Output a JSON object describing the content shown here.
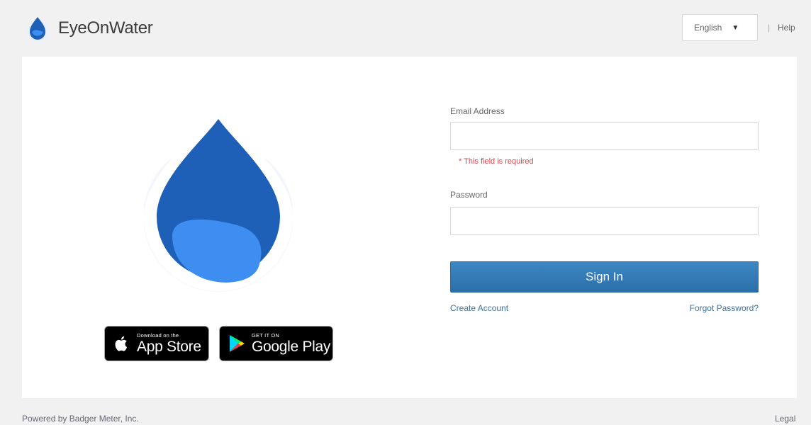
{
  "header": {
    "brand_name": "EyeOnWater",
    "language": {
      "selected": "English"
    },
    "separator": "|",
    "help_label": "Help"
  },
  "login": {
    "email_label": "Email Address",
    "email_value": "",
    "email_error": "* This field is required",
    "password_label": "Password",
    "password_value": "",
    "signin_label": "Sign In",
    "create_account_label": "Create Account",
    "forgot_password_label": "Forgot Password?"
  },
  "badges": {
    "app_store": {
      "small": "Download on the",
      "big": "App Store"
    },
    "google_play": {
      "small": "GET IT ON",
      "big": "Google Play"
    }
  },
  "footer": {
    "powered_by": "Powered by Badger Meter, Inc.",
    "legal_label": "Legal"
  },
  "colors": {
    "brand_blue": "#1e5fb8",
    "brand_light_blue": "#3d8ef0",
    "button_blue": "#2f78b4",
    "error_red": "#e0424a"
  },
  "icons": {
    "brand": "water-drop-icon",
    "caret": "caret-down-icon",
    "apple": "apple-icon",
    "play": "google-play-icon"
  }
}
